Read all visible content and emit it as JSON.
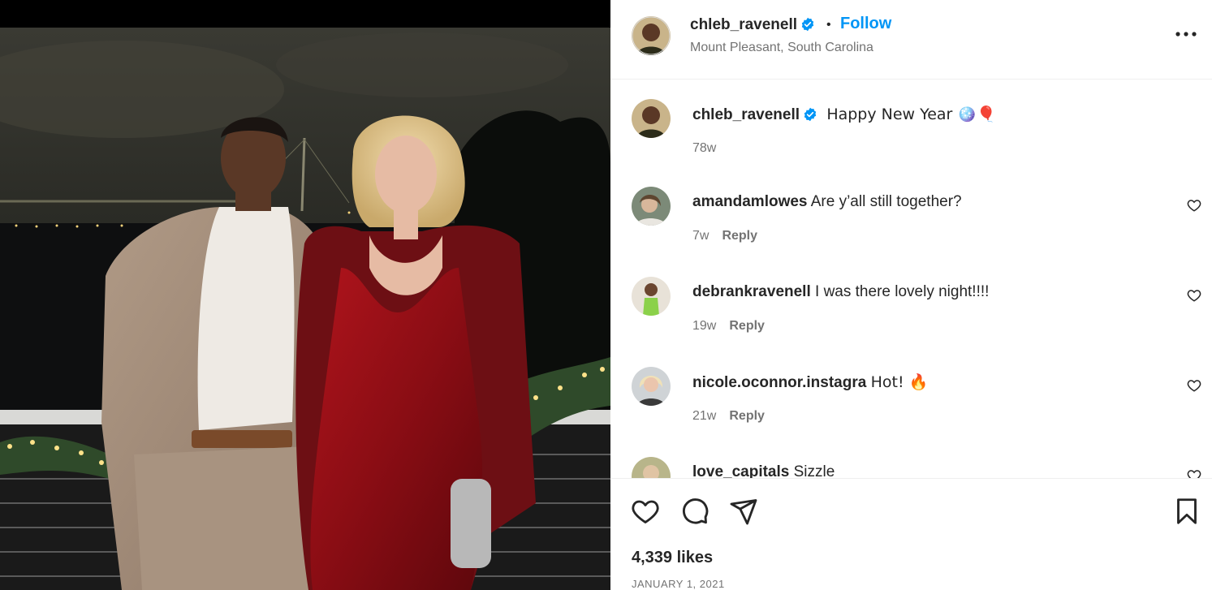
{
  "post": {
    "username": "chleb_ravenell",
    "follow_label": "Follow",
    "location": "Mount Pleasant, South Carolina",
    "caption": "Happy New Year 🪩🎈",
    "caption_time": "78w",
    "likes": "4,339 likes",
    "date": "JANUARY 1, 2021"
  },
  "comments": [
    {
      "username": "amandamlowes",
      "text": "Are y’all still together?",
      "time": "7w",
      "reply": "Reply"
    },
    {
      "username": "debrankravenell",
      "text": "I was there lovely night!!!!",
      "time": "19w",
      "reply": "Reply"
    },
    {
      "username": "nicole.oconnor.instagra",
      "text": "Hot! 🔥",
      "time": "21w",
      "reply": "Reply"
    },
    {
      "username": "love_capitals",
      "text": "Sizzle"
    }
  ],
  "icons": {
    "verified": "verified-badge-icon",
    "more": "more-options-icon",
    "like": "heart-icon",
    "comment": "comment-icon",
    "share": "share-icon",
    "save": "bookmark-icon"
  },
  "colors": {
    "accent": "#0095f6",
    "verified": "#0095f6",
    "secondary_text": "#737373"
  }
}
